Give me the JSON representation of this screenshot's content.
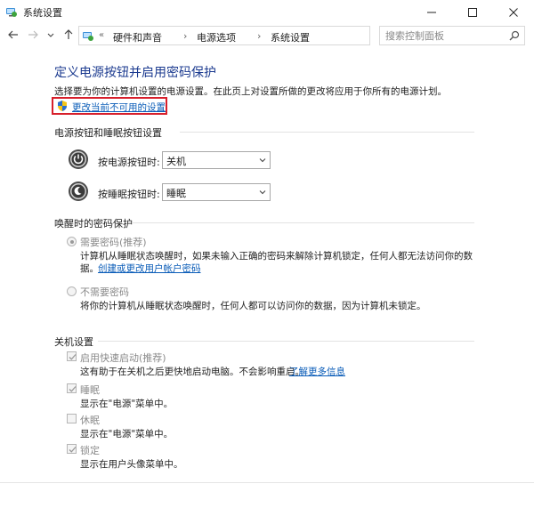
{
  "window": {
    "title": "系统设置",
    "controls": [
      "minimize-icon",
      "maximize-icon",
      "close-icon"
    ]
  },
  "address": {
    "prefix": "«",
    "crumbs": [
      "硬件和声音",
      "电源选项",
      "系统设置"
    ],
    "separator": "›"
  },
  "search": {
    "placeholder": "搜索控制面板"
  },
  "page": {
    "title": "定义电源按钮并启用密码保护",
    "description": "选择要为你的计算机设置的电源设置。在此页上对设置所做的更改将应用于你所有的电源计划。",
    "change_link": "更改当前不可用的设置"
  },
  "power_buttons": {
    "header": "电源按钮和睡眠按钮设置",
    "items": [
      {
        "label": "按电源按钮时:",
        "value": "关机",
        "icon": "power-icon"
      },
      {
        "label": "按睡眠按钮时:",
        "value": "睡眠",
        "icon": "sleep-icon"
      }
    ]
  },
  "password": {
    "header": "唤醒时的密码保护",
    "require": {
      "label": "需要密码(推荐)",
      "desc": "计算机从睡眠状态唤醒时，如果未输入正确的密码来解除计算机锁定，任何人都无法访问你的数",
      "desc2": "据。",
      "link": "创建或更改用户帐户密码",
      "checked": true
    },
    "no_require": {
      "label": "不需要密码",
      "desc": "将你的计算机从睡眠状态唤醒时，任何人都可以访问你的数据，因为计算机未锁定。",
      "checked": false
    }
  },
  "shutdown": {
    "header": "关机设置",
    "fast_startup": {
      "label": "启用快速启动(推荐)",
      "desc": "这有助于在关机之后更快地启动电脑。不会影响重启。",
      "link": "了解更多信息",
      "checked": true
    },
    "items": [
      {
        "label": "睡眠",
        "desc": "显示在\"电源\"菜单中。",
        "checked": true
      },
      {
        "label": "休眠",
        "desc": "显示在\"电源\"菜单中。",
        "checked": false
      },
      {
        "label": "锁定",
        "desc": "显示在用户头像菜单中。",
        "checked": true
      }
    ]
  },
  "colors": {
    "title_blue": "#1b3a8f",
    "link_blue": "#0a5cb8",
    "highlight_red": "#d71f2b",
    "disabled_gray": "#8a8a8a"
  }
}
